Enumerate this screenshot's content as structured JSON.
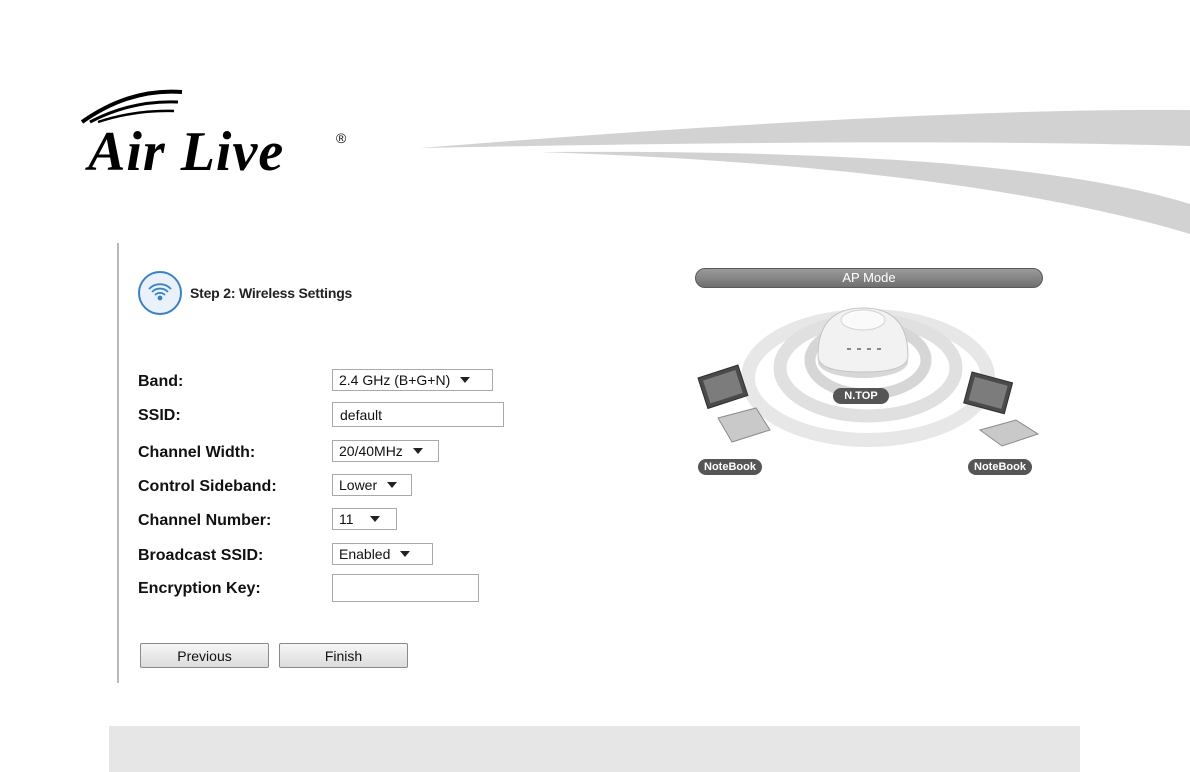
{
  "brand": {
    "logo_text": "Air Live",
    "registered_mark": "®"
  },
  "step": {
    "title": "Step 2: Wireless Settings",
    "icon": "wifi-icon"
  },
  "form": {
    "band": {
      "label": "Band:",
      "value": "2.4 GHz (B+G+N)"
    },
    "ssid": {
      "label": "SSID:",
      "value": "default"
    },
    "channel_width": {
      "label": "Channel Width:",
      "value": "20/40MHz"
    },
    "control_sideband": {
      "label": "Control Sideband:",
      "value": "Lower"
    },
    "channel_number": {
      "label": "Channel Number:",
      "value": "11"
    },
    "broadcast_ssid": {
      "label": "Broadcast SSID:",
      "value": "Enabled"
    },
    "encryption_key": {
      "label": "Encryption Key:",
      "value": ""
    }
  },
  "buttons": {
    "previous": "Previous",
    "finish": "Finish"
  },
  "diagram": {
    "mode": "AP Mode",
    "device_label": "N.TOP",
    "client_left": "NoteBook",
    "client_right": "NoteBook"
  },
  "colors": {
    "accent": "#3b82c4",
    "pill": "#777777",
    "footer": "#e6e6e6"
  }
}
